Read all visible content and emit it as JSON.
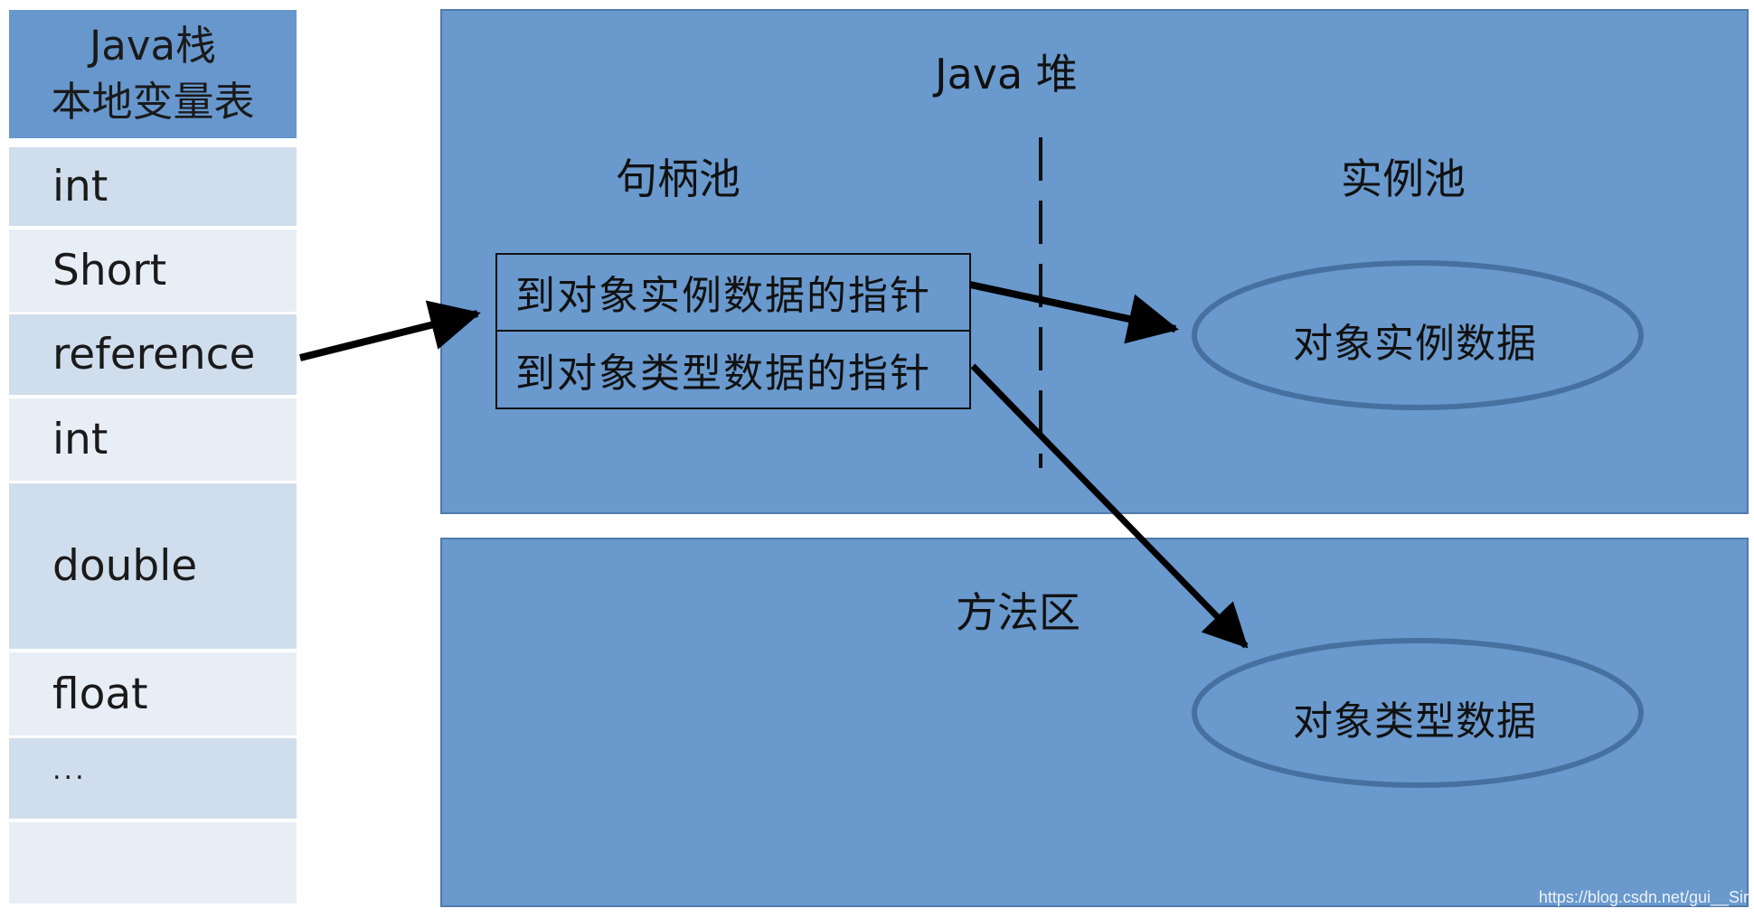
{
  "stack": {
    "title_line1": "Java栈",
    "title_line2": "本地变量表",
    "rows": [
      {
        "label": "int"
      },
      {
        "label": "Short"
      },
      {
        "label": "reference"
      },
      {
        "label": "int"
      },
      {
        "label": "double"
      },
      {
        "label": "float"
      },
      {
        "label": "..."
      },
      {
        "label": ""
      }
    ]
  },
  "heap": {
    "title": "Java 堆",
    "handle_pool": {
      "title": "句柄池",
      "cells": [
        {
          "label": "到对象实例数据的指针"
        },
        {
          "label": "到对象类型数据的指针"
        }
      ]
    },
    "instance_pool": {
      "title": "实例池",
      "object_instance_data": "对象实例数据"
    }
  },
  "method_area": {
    "title": "方法区",
    "object_type_data": "对象类型数据"
  },
  "colors": {
    "region_fill": "#6999cd",
    "stack_header": "#6797cd",
    "row_dark": "#d0ddec",
    "row_light": "#e8eef6",
    "ellipse_stroke": "#46709f",
    "arrow": "#000000"
  },
  "watermark": "https://blog.csdn.net/gui__Sir"
}
